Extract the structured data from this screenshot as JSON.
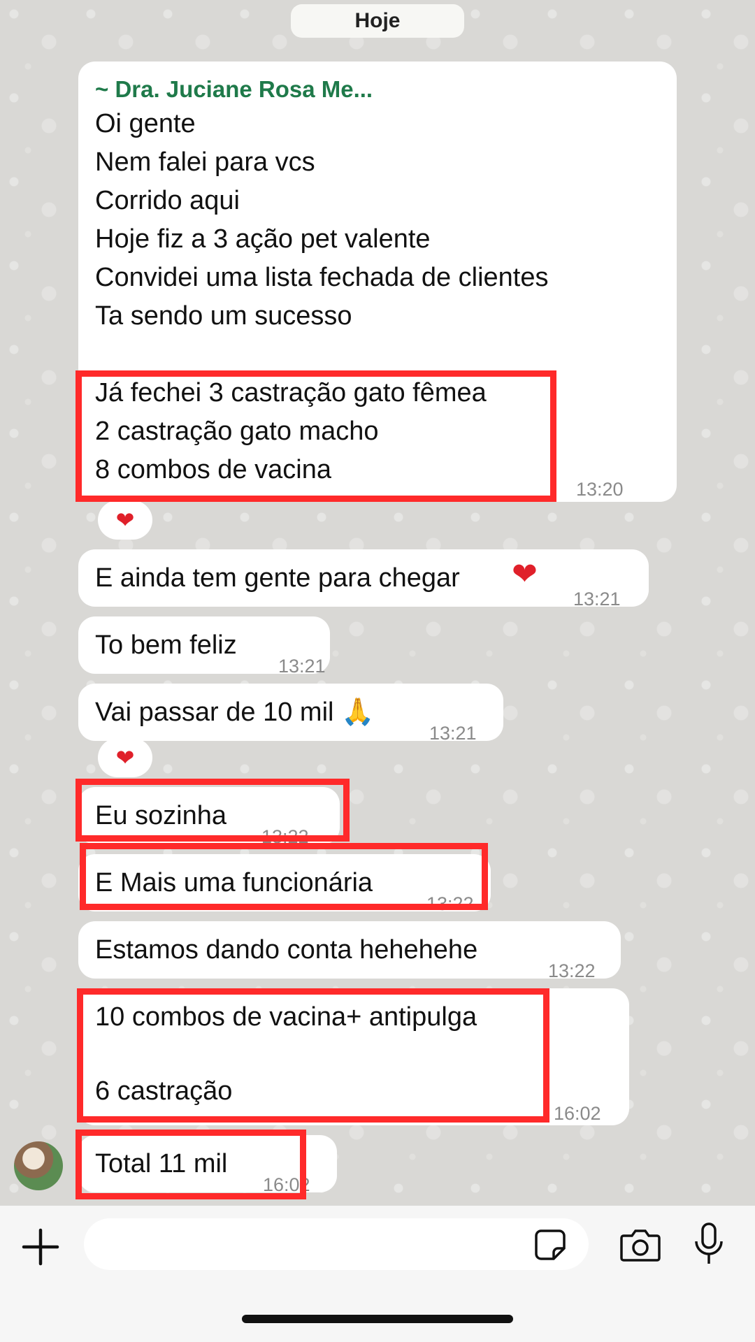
{
  "date_chip": "Hoje",
  "messages": [
    {
      "sender": "~ Dra. Juciane Rosa Me...",
      "lines": [
        "Oi gente",
        "Nem falei para vcs",
        "Corrido aqui",
        "Hoje fiz a 3 ação pet valente",
        "Convidei uma lista fechada de clientes",
        "Ta sendo um sucesso",
        "",
        "Já fechei 3 castração gato fêmea",
        "2 castração gato macho",
        "8 combos de vacina"
      ],
      "time": "13:20",
      "reaction": "❤"
    },
    {
      "text": "E ainda tem gente para chegar",
      "emoji": "❤",
      "time": "13:21"
    },
    {
      "text": "To bem feliz",
      "time": "13:21"
    },
    {
      "text": "Vai passar de 10 mil 🙏",
      "time": "13:21",
      "reaction": "❤"
    },
    {
      "text": "Eu sozinha",
      "time": "13:22"
    },
    {
      "text": "E Mais uma funcionária",
      "time": "13:22"
    },
    {
      "text": "Estamos dando conta hehehehe",
      "time": "13:22"
    },
    {
      "lines": [
        "10 combos de vacina+ antipulga",
        "",
        "6 castração"
      ],
      "time": "16:02"
    },
    {
      "text": "Total 11 mil",
      "time": "16:02"
    }
  ],
  "colors": {
    "highlight": "#ff2a2a",
    "sender": "#1f7a4a",
    "reaction": "#e0202a"
  },
  "input": {
    "placeholder": ""
  },
  "icons": {
    "plus": "plus-icon",
    "sticker": "sticker-icon",
    "camera": "camera-icon",
    "mic": "microphone-icon"
  }
}
